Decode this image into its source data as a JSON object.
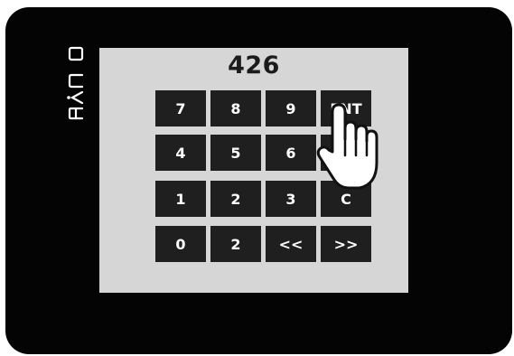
{
  "brand": "EVCO",
  "display": {
    "value": "426"
  },
  "keypad": {
    "keys": [
      [
        "7",
        "8",
        "9",
        "ENT"
      ],
      [
        "4",
        "5",
        "6",
        ""
      ],
      [
        "1",
        "2",
        "3",
        "C"
      ],
      [
        "0",
        "2",
        "<<",
        ">>"
      ]
    ]
  },
  "colors": {
    "bezel": "#040404",
    "screen": "#d6d6d6",
    "key": "#1f1f1f",
    "key_text": "#ffffff"
  },
  "icons": {
    "pointer": "hand-pointer-icon",
    "logo": "evco-logo"
  }
}
